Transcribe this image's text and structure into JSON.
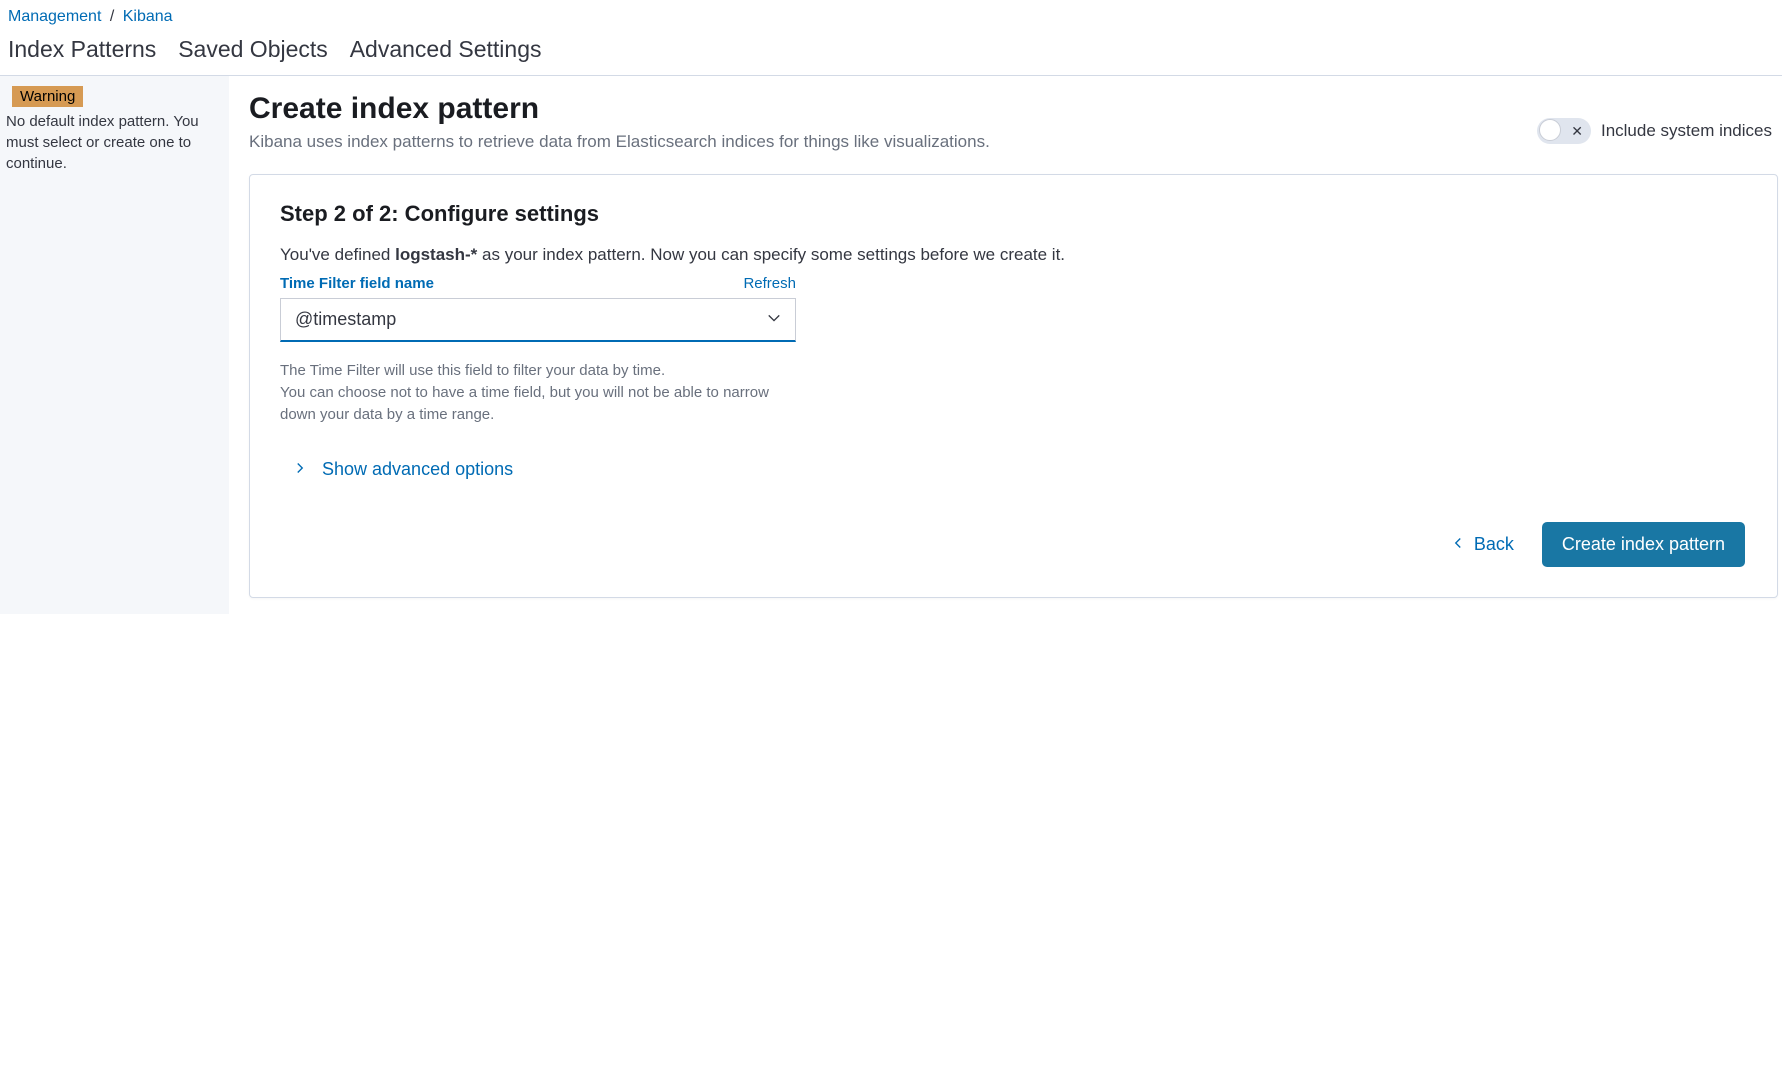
{
  "breadcrumb": {
    "management": "Management",
    "kibana": "Kibana"
  },
  "tabs": {
    "index_patterns": "Index Patterns",
    "saved_objects": "Saved Objects",
    "advanced_settings": "Advanced Settings"
  },
  "sidebar": {
    "warning_label": "Warning",
    "warning_text": "No default index pattern. You must select or create one to continue."
  },
  "header": {
    "title": "Create index pattern",
    "subtitle": "Kibana uses index patterns to retrieve data from Elasticsearch indices for things like visualizations.",
    "toggle_label": "Include system indices"
  },
  "step": {
    "title": "Step 2 of 2: Configure settings",
    "desc_pre": "You've defined ",
    "pattern": "logstash-*",
    "desc_post": " as your index pattern. Now you can specify some settings before we create it.",
    "field_label": "Time Filter field name",
    "refresh": "Refresh",
    "selected_value": "@timestamp",
    "help1": "The Time Filter will use this field to filter your data by time.",
    "help2": "You can choose not to have a time field, but you will not be able to narrow down your data by a time range.",
    "advanced": "Show advanced options"
  },
  "footer": {
    "back": "Back",
    "create": "Create index pattern"
  }
}
